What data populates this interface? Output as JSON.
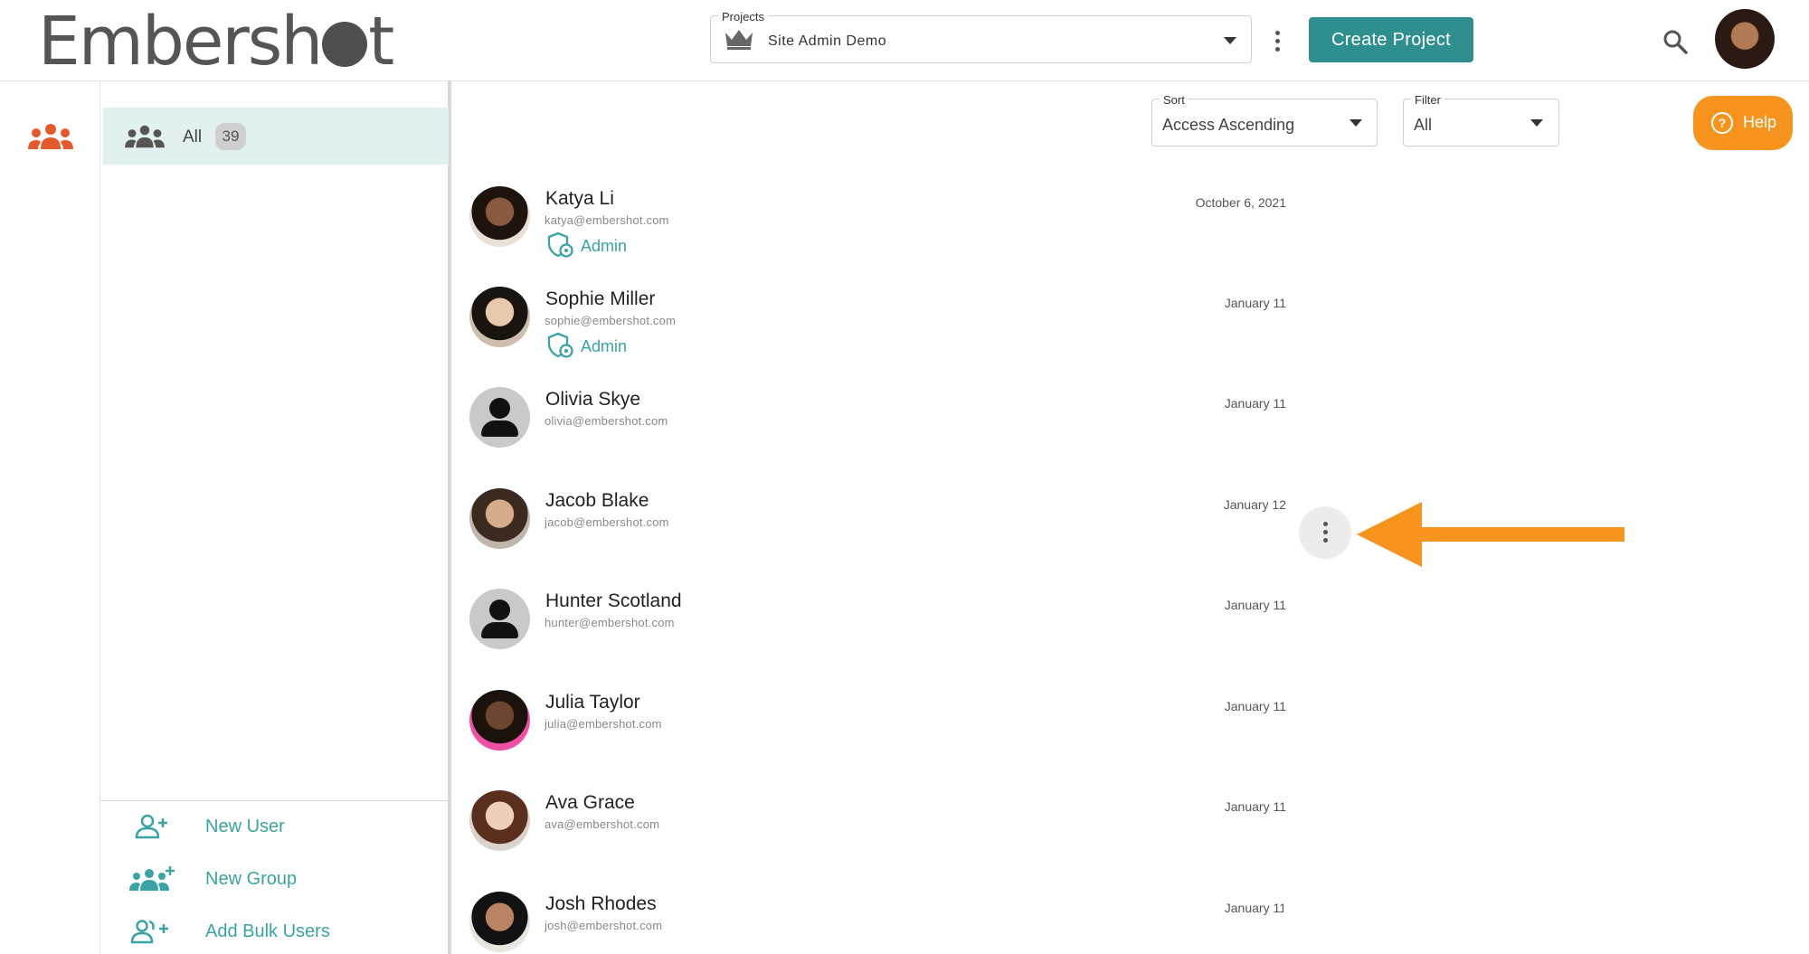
{
  "app": {
    "logo_prefix": "Embersh",
    "logo_suffix": "t",
    "help_label": "Help"
  },
  "header": {
    "projects_label": "Projects",
    "project_value": "Site Admin Demo",
    "create_project_label": "Create Project"
  },
  "sidebar": {
    "all_label": "All",
    "all_count": "39",
    "actions": [
      {
        "label": "New User",
        "icon": "add-user-icon"
      },
      {
        "label": "New Group",
        "icon": "add-group-icon"
      },
      {
        "label": "Add Bulk Users",
        "icon": "add-bulk-users-icon"
      }
    ]
  },
  "controls": {
    "sort_label": "Sort",
    "sort_value": "Access Ascending",
    "filter_label": "Filter",
    "filter_value": "All"
  },
  "users": [
    {
      "name": "Katya Li",
      "email": "katya@embershot.com",
      "role": "Admin",
      "date": "October 6, 2021",
      "avatar": "photo"
    },
    {
      "name": "Sophie Miller",
      "email": "sophie@embershot.com",
      "role": "Admin",
      "date": "January 11",
      "avatar": "photo"
    },
    {
      "name": "Olivia Skye",
      "email": "olivia@embershot.com",
      "role": "",
      "date": "January 11",
      "avatar": "placeholder"
    },
    {
      "name": "Jacob Blake",
      "email": "jacob@embershot.com",
      "role": "",
      "date": "January 12",
      "avatar": "photo"
    },
    {
      "name": "Hunter Scotland",
      "email": "hunter@embershot.com",
      "role": "",
      "date": "January 11",
      "avatar": "placeholder"
    },
    {
      "name": "Julia Taylor",
      "email": "julia@embershot.com",
      "role": "",
      "date": "January 11",
      "avatar": "photo"
    },
    {
      "name": "Ava Grace",
      "email": "ava@embershot.com",
      "role": "",
      "date": "January 11",
      "avatar": "photo"
    },
    {
      "name": "Josh Rhodes",
      "email": "josh@embershot.com",
      "role": "",
      "date": "January 11",
      "avatar": "photo"
    }
  ],
  "colors": {
    "brand_teal": "#2f8f8f",
    "accent_orange": "#f7941d",
    "link_teal": "#3aa3a3"
  }
}
